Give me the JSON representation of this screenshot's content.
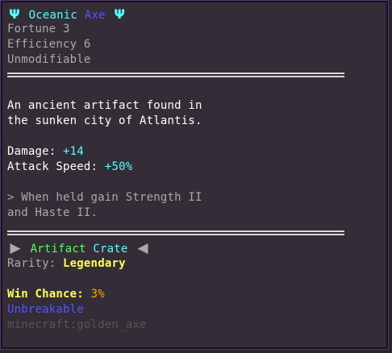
{
  "title": {
    "prefix_icon": "trident-icon",
    "word1": "Oceanic",
    "word2": "Axe",
    "suffix_icon": "trident-icon"
  },
  "enchants": [
    "Fortune 3",
    "Efficiency 6",
    "Unmodifiable"
  ],
  "lore": [
    "An ancient artifact found in",
    "the sunken city of Atlantis."
  ],
  "stats": {
    "damage_label": "Damage:",
    "damage_value": "+14",
    "speed_label": "Attack Speed:",
    "speed_value": "+50%"
  },
  "ability": [
    "> When held gain Strength II",
    "and Haste II."
  ],
  "crate": {
    "left_icon": "triangle-right-icon",
    "name1": "Artifact",
    "name2": "Crate",
    "right_icon": "triangle-left-icon"
  },
  "rarity": {
    "label": "Rarity:",
    "value": "Legendary"
  },
  "win": {
    "label": "Win Chance:",
    "value": "3%"
  },
  "unbreakable": "Unbreakable",
  "item_id": "minecraft:golden_axe",
  "colors": {
    "aqua": "#55ffff",
    "blue": "#5555ff",
    "gray": "#aaaaaa",
    "green": "#55ff55",
    "yellow": "#ffff55",
    "gold": "#ffaa00",
    "dark_gray": "#555555",
    "background": "#342d37"
  }
}
